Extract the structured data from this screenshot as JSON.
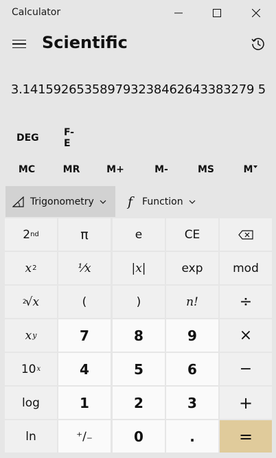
{
  "window": {
    "title": "Calculator"
  },
  "header": {
    "mode_title": "Scientific"
  },
  "display": {
    "value": "3.141592653589793238462643383279 5"
  },
  "modes": {
    "angle": "DEG",
    "fe": "F-E"
  },
  "memory": [
    "MC",
    "MR",
    "M+",
    "M-",
    "MS",
    "M"
  ],
  "functions": {
    "trig_label": "Trigonometry",
    "func_label": "Function",
    "func_icon": "f"
  },
  "keys": {
    "second": "2",
    "second_sup": "nd",
    "pi": "π",
    "e": "e",
    "ce": "CE",
    "x2": "x",
    "x2_sup": "2",
    "recip": "⅟x",
    "abs": "|x|",
    "exp": "exp",
    "mod": "mod",
    "root_idx": "2",
    "root": "√x",
    "lparen": "(",
    "rparen": ")",
    "fact": "n!",
    "div": "÷",
    "xy": "x",
    "xy_sup": "y",
    "tenx": "10",
    "tenx_sup": "x",
    "log": "log",
    "ln": "ln",
    "n7": "7",
    "n8": "8",
    "n9": "9",
    "n4": "4",
    "n5": "5",
    "n6": "6",
    "n1": "1",
    "n2": "2",
    "n3": "3",
    "n0": "0",
    "dot": ".",
    "negate": "⁺∕₋",
    "mul": "×",
    "minus": "−",
    "plus": "+",
    "eq": "="
  }
}
